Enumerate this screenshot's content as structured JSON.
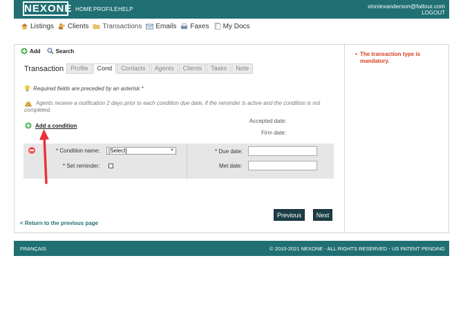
{
  "header": {
    "logo": "NEXONE",
    "nav": [
      "HOME",
      "PROFILE",
      "HELP"
    ],
    "user_email": "xinniexanderson@faltour.com",
    "logout": "LOGOUT"
  },
  "modules": [
    {
      "label": "Listings",
      "icon": "house-icon"
    },
    {
      "label": "Clients",
      "icon": "clients-icon"
    },
    {
      "label": "Transactions",
      "icon": "folder-icon"
    },
    {
      "label": "Emails",
      "icon": "envelope-icon"
    },
    {
      "label": "Faxes",
      "icon": "fax-icon"
    },
    {
      "label": "My Docs",
      "icon": "docs-icon"
    }
  ],
  "actions": {
    "add": "Add",
    "search": "Search"
  },
  "tabs": {
    "title": "Transaction",
    "items": [
      "Profile",
      "Cond",
      "Contacts",
      "Agents",
      "Clients",
      "Tasks",
      "Note"
    ],
    "active_index": 1
  },
  "notes": {
    "required": "Required fields are preceded by an asterisk *",
    "reminder": "Agents receive a notification 2 days prior to each condition due date, if the reminder is active and the condition is not completed."
  },
  "conditions": {
    "add_link": "Add a condition",
    "accepted_label": "Accepted date:",
    "firm_label": "Firm date:",
    "condition_name_label": "* Condition name:",
    "condition_name_value": "[Select]",
    "set_reminder_label": "* Set reminder:",
    "due_date_label": "* Due date:",
    "met_date_label": "Met date:",
    "due_date_value": "",
    "met_date_value": ""
  },
  "buttons": {
    "previous": "Previous",
    "next": "Next"
  },
  "return_link": "< Return to the previous page",
  "side": {
    "error": "The transaction type is mandatory."
  },
  "footer": {
    "language": "FRANÇAIS",
    "copyright": "© 2010-2021 NEXONE - ALL RIGHTS RESERVED - US PATENT PENDING"
  },
  "colors": {
    "brand": "#1f6f73",
    "error": "#d63d1c",
    "annotation_arrow": "#e8333a"
  }
}
